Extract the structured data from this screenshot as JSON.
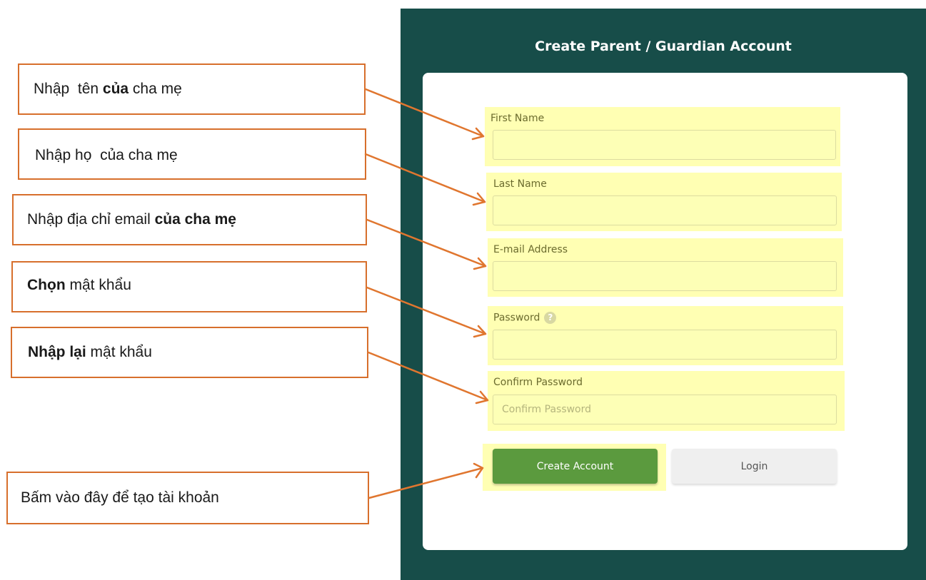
{
  "form": {
    "title": "Create Parent / Guardian Account",
    "fields": [
      {
        "label": "First Name",
        "value": "",
        "placeholder": ""
      },
      {
        "label": "Last Name",
        "value": "",
        "placeholder": ""
      },
      {
        "label": "E-mail Address",
        "value": "",
        "placeholder": ""
      },
      {
        "label": "Password",
        "value": "",
        "placeholder": "",
        "help_icon": "?"
      },
      {
        "label": "Confirm Password",
        "value": "",
        "placeholder": "Confirm Password"
      }
    ],
    "create_button": "Create Account",
    "login_button": "Login"
  },
  "callouts": [
    {
      "pre": "Nhập  tên ",
      "bold": "của",
      "post": " cha mẹ"
    },
    {
      "pre": "Nhập họ  của cha mẹ",
      "bold": "",
      "post": ""
    },
    {
      "pre": "Nhập địa chỉ email ",
      "bold": "của cha mẹ",
      "post": ""
    },
    {
      "pre": "",
      "bold": "Chọn",
      "post": " mật khẩu"
    },
    {
      "pre": "",
      "bold": "Nhập lại",
      "post": " mật khẩu"
    },
    {
      "pre": "Bấm vào đây để tạo tài khoản",
      "bold": "",
      "post": ""
    }
  ],
  "colors": {
    "panel": "#174d49",
    "highlight": "#ffffb3",
    "callout_border": "#d76f2c",
    "create_button": "#5b9a3e"
  }
}
